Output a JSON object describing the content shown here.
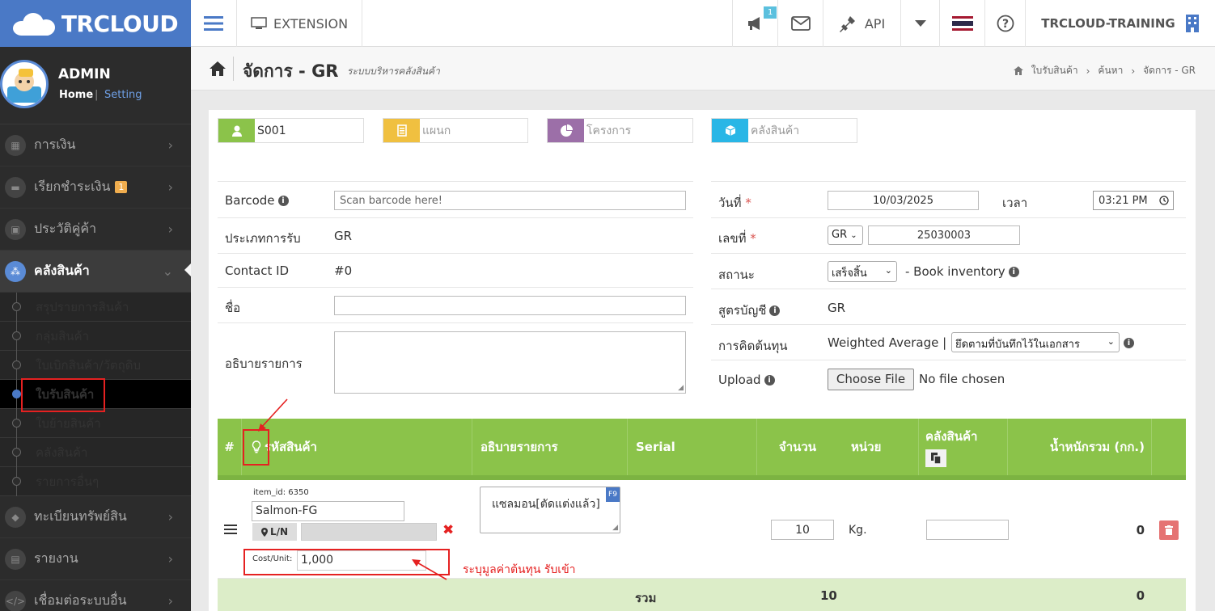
{
  "brand": {
    "name": "TRCLOUD"
  },
  "profile": {
    "name": "ADMIN",
    "home": "Home",
    "sep": "|",
    "setting": "Setting"
  },
  "sidebar": {
    "menus": [
      {
        "label": "การเงิน",
        "icon": "calendar-icon"
      },
      {
        "label": "เรียกชำระเงิน",
        "icon": "card-icon",
        "badge": "1"
      },
      {
        "label": "ประวัติคู่ค้า",
        "icon": "contact-icon"
      },
      {
        "label": "คลังสินค้า",
        "icon": "boxes-icon",
        "active": true
      }
    ],
    "subitems": [
      "สรุปรายการสินค้า",
      "กลุ่มสินค้า",
      "ใบเบิกสินค้า/วัตถุดิบ",
      "ใบรับสินค้า",
      "ใบย้ายสินค้า",
      "คลังสินค้า",
      "รายการอื่นๆ"
    ],
    "lower_menus": [
      {
        "label": "ทะเบียนทรัพย์สิน",
        "icon": "diamond-icon"
      },
      {
        "label": "รายงาน",
        "icon": "report-icon"
      },
      {
        "label": "เชื่อมต่อระบบอื่น",
        "icon": "code-icon"
      }
    ]
  },
  "topbar": {
    "extension": "EXTENSION",
    "notify_count": "1",
    "api": "API",
    "company": "TRCLOUD-TRAINING"
  },
  "page": {
    "title": "จัดการ - GR",
    "subtitle": "ระบบบริหารคลังสินค้า",
    "breadcrumb": [
      "ใบรับสินค้า",
      "ค้นหา",
      "จัดการ - GR"
    ]
  },
  "chips": {
    "staff": "S001",
    "department_placeholder": "แผนก",
    "project_placeholder": "โครงการ",
    "warehouse_placeholder": "คลังสินค้า"
  },
  "form_left": {
    "barcode_label": "Barcode",
    "barcode_placeholder": "Scan barcode here!",
    "type_label": "ประเภทการรับ",
    "type_value": "GR",
    "contact_label": "Contact ID",
    "contact_value": "#0",
    "name_label": "ชื่อ",
    "desc_label": "อธิบายรายการ"
  },
  "form_right": {
    "date_label": "วันที่",
    "date_value": "10/03/2025",
    "time_label": "เวลา",
    "time_value": "03:21 PM",
    "no_label": "เลขที่",
    "no_prefix": "GR",
    "no_value": "25030003",
    "status_label": "สถานะ",
    "status_value": "เสร็จสิ้น",
    "status_note": "- Book inventory",
    "formula_label": "สูตรบัญชี",
    "formula_value": "GR",
    "cost_label": "การคิดต้นทุน",
    "cost_method": "Weighted Average |",
    "cost_select": "ยึดตามที่บันทึกไว้ในเอกสาร",
    "upload_label": "Upload",
    "upload_button": "Choose File",
    "upload_status": "No file chosen"
  },
  "table": {
    "headers": [
      "#",
      "รหัสสินค้า",
      "อธิบายรายการ",
      "Serial",
      "จำนวน",
      "หน่วย",
      "คลังสินค้า",
      "น้ำหนักรวม (กก.)"
    ],
    "row": {
      "item_id": "item_id: 6350",
      "code": "Salmon-FG",
      "ln": "L/N",
      "description": "แซลมอน[ตัดแต่งแล้ว]",
      "f9": "F9",
      "qty": "10",
      "unit": "Kg.",
      "weight": "0",
      "cost_label": "Cost/Unit:",
      "cost_value": "1,000"
    },
    "totals": {
      "label": "รวม",
      "qty": "10",
      "weight": "0"
    }
  },
  "annotation": {
    "text": "ระบุมูลค่าต้นทุน รับเข้า"
  },
  "colors": {
    "brand": "#4a79c6",
    "header_green": "#8bc34a",
    "total_green": "#dcedc8",
    "annotation": "#e52121"
  }
}
